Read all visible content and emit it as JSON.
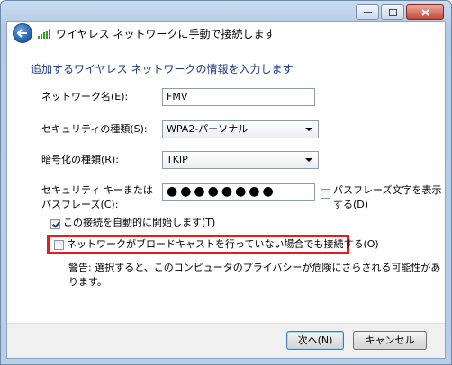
{
  "window": {
    "title": "ワイヤレス ネットワークに手動で接続します"
  },
  "instruction": "追加するワイヤレス ネットワークの情報を入力します",
  "fields": {
    "network_name": {
      "label": "ネットワーク名(E):",
      "value": "FMV"
    },
    "security_type": {
      "label": "セキュリティの種類(S):",
      "value": "WPA2-パーソナル"
    },
    "encryption_type": {
      "label": "暗号化の種類(R):",
      "value": "TKIP"
    },
    "security_key": {
      "label_line1": "セキュリティ キーまたは",
      "label_line2": "パスフレーズ(C):",
      "value": "●●●●●●●●"
    }
  },
  "checkboxes": {
    "show_chars": {
      "label_line1": "パスフレーズ文字を表示",
      "label_line2": "する(D)",
      "checked": false
    },
    "auto_connect": {
      "label": "この接続を自動的に開始します(T)",
      "checked": true
    },
    "connect_hidden": {
      "label": "ネットワークがブロードキャストを行っていない場合でも接続する(O)",
      "checked": false
    }
  },
  "warning": "警告: 選択すると、このコンピュータのプライバシーが危険にさらされる可能性があります。",
  "buttons": {
    "next": "次へ(N)",
    "cancel": "キャンセル"
  },
  "colors": {
    "instruction_text": "#1c3a8a",
    "highlight": "#e81a1a",
    "title_bar": "#b9cfe8"
  },
  "icons": {
    "back": "back-arrow-icon",
    "network": "wireless-signal-icon"
  }
}
